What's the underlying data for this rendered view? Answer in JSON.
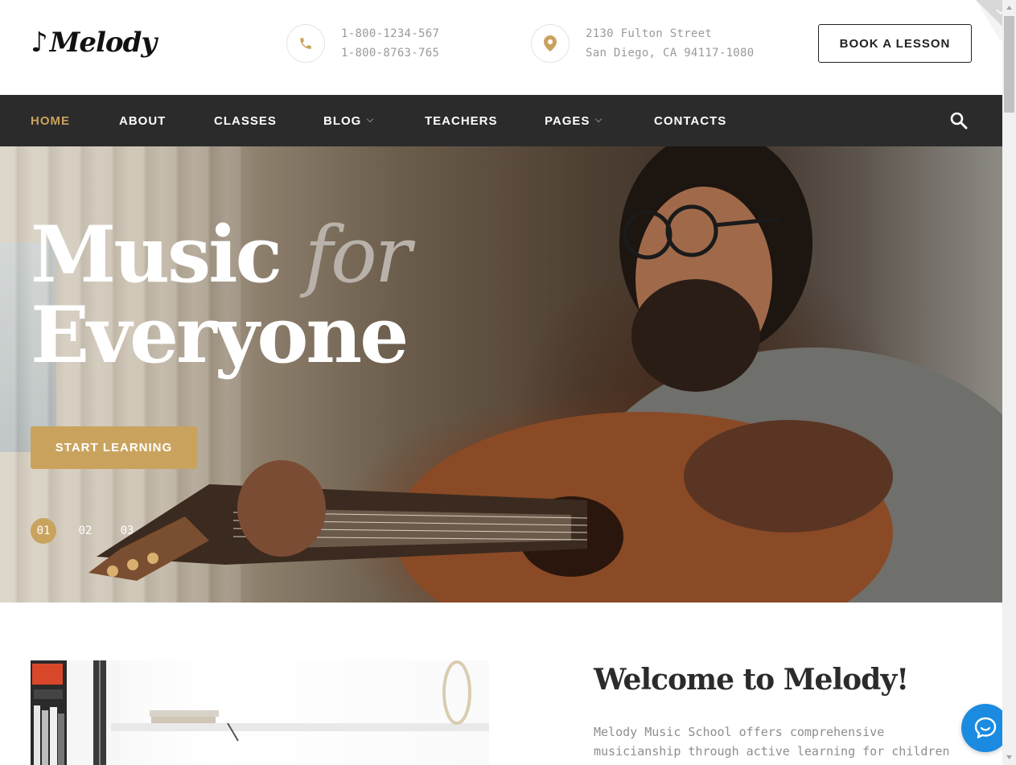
{
  "header": {
    "logo_text": "Melody",
    "logo_glyph": "♪",
    "phone_lines": [
      "1-800-1234-567",
      "1-800-8763-765"
    ],
    "address_lines": [
      "2130 Fulton Street",
      "San Diego, CA 94117-1080"
    ],
    "book_label": "BOOK A LESSON",
    "icons": {
      "phone": "phone-icon",
      "location": "location-pin-icon"
    }
  },
  "nav": {
    "items": [
      {
        "label": "HOME",
        "active": true
      },
      {
        "label": "ABOUT"
      },
      {
        "label": "CLASSES"
      },
      {
        "label": "BLOG",
        "has_dropdown": true
      },
      {
        "label": "TEACHERS"
      },
      {
        "label": "PAGES",
        "has_dropdown": true
      },
      {
        "label": "CONTACTS"
      }
    ],
    "search_icon": "search-icon"
  },
  "hero": {
    "title_word1": "Music",
    "title_accent": "for",
    "title_line2": "Everyone",
    "cta_label": "START LEARNING",
    "slides": [
      "01",
      "02",
      "03"
    ],
    "active_slide": "01"
  },
  "welcome": {
    "title": "Welcome to Melody!",
    "text": "Melody Music School offers comprehensive musicianship through active learning for children and adults. Our music"
  },
  "colors": {
    "accent": "#c9a35e",
    "nav_bg": "#2b2b2b",
    "chat": "#1a8be0"
  },
  "chat_icon": "chat-bubble-icon"
}
